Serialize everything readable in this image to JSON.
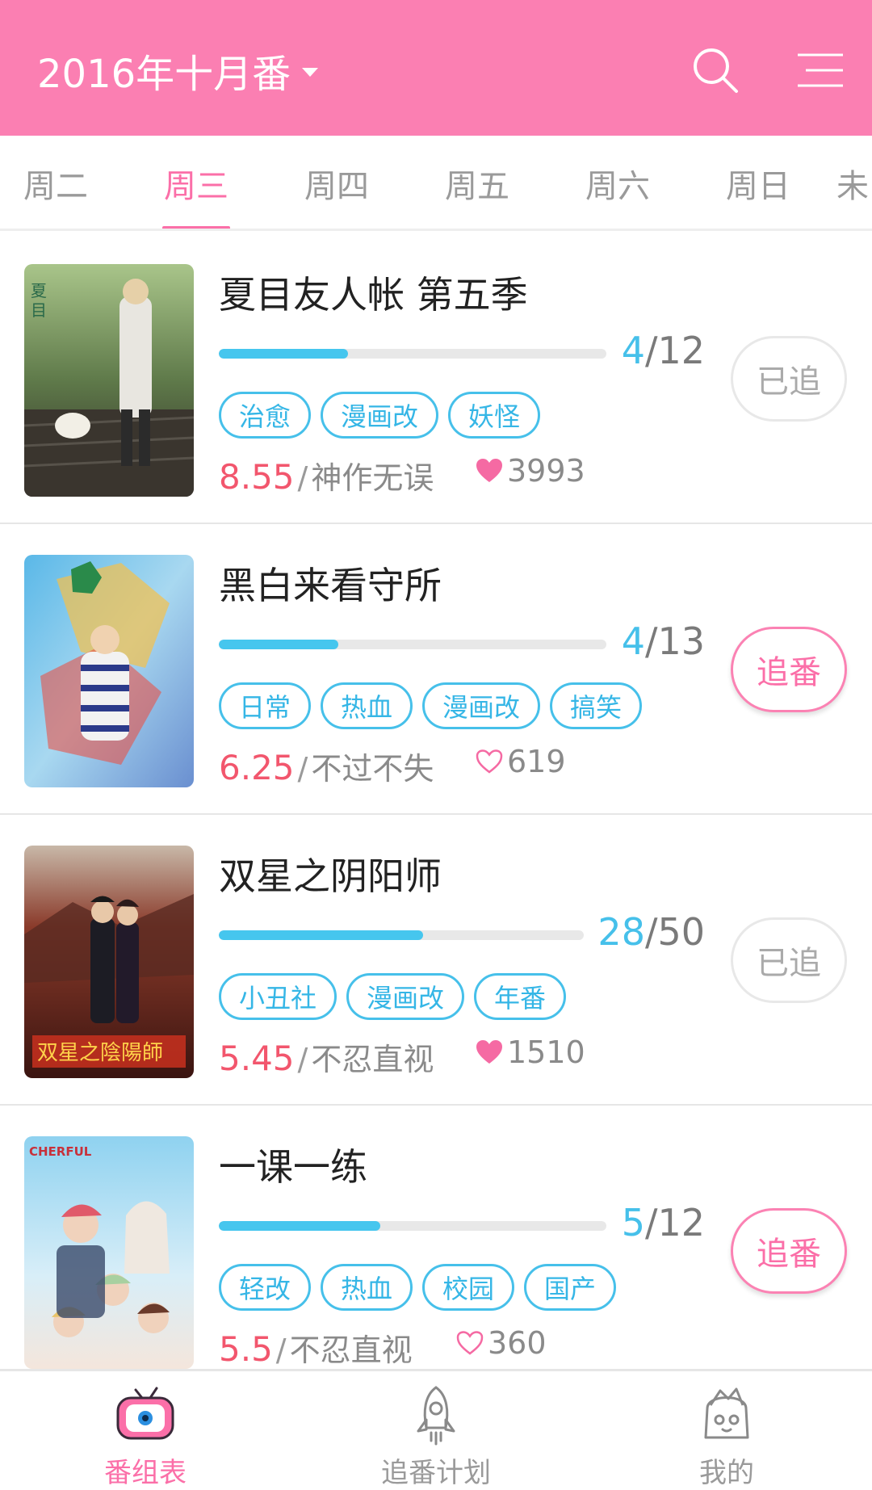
{
  "header": {
    "title": "2016年十月番",
    "search_icon": "search-icon",
    "menu_icon": "menu-icon",
    "background": "#fb7fb2"
  },
  "tabs": [
    {
      "label": "周二",
      "active": false
    },
    {
      "label": "周三",
      "active": true
    },
    {
      "label": "周四",
      "active": false
    },
    {
      "label": "周五",
      "active": false
    },
    {
      "label": "周六",
      "active": false
    },
    {
      "label": "周日",
      "active": false
    },
    {
      "label": "未",
      "active": false
    }
  ],
  "anime": [
    {
      "title": "夏目友人帐 第五季",
      "episode_current": "4",
      "episode_total": "/12",
      "progress": 0.333,
      "tags": [
        "治愈",
        "漫画改",
        "妖怪"
      ],
      "score": "8.55",
      "verdict": "神作无误",
      "likes": "3993",
      "liked": true,
      "button": "已追",
      "followed": true
    },
    {
      "title": "黑白来看守所",
      "episode_current": "4",
      "episode_total": "/13",
      "progress": 0.308,
      "tags": [
        "日常",
        "热血",
        "漫画改",
        "搞笑"
      ],
      "score": "6.25",
      "verdict": "不过不失",
      "likes": "619",
      "liked": false,
      "button": "追番",
      "followed": false
    },
    {
      "title": "双星之阴阳师",
      "episode_current": "28",
      "episode_total": "/50",
      "progress": 0.56,
      "tags": [
        "小丑社",
        "漫画改",
        "年番"
      ],
      "score": "5.45",
      "verdict": "不忍直视",
      "likes": "1510",
      "liked": true,
      "button": "已追",
      "followed": true
    },
    {
      "title": "一课一练",
      "episode_current": "5",
      "episode_total": "/12",
      "progress": 0.417,
      "tags": [
        "轻改",
        "热血",
        "校园",
        "国产"
      ],
      "score": "5.5",
      "verdict": "不忍直视",
      "likes": "360",
      "liked": false,
      "button": "追番",
      "followed": false
    }
  ],
  "bottom_nav": [
    {
      "label": "番组表",
      "icon": "tv-icon",
      "active": true
    },
    {
      "label": "追番计划",
      "icon": "rocket-icon",
      "active": false
    },
    {
      "label": "我的",
      "icon": "profile-character-icon",
      "active": false
    }
  ],
  "colors": {
    "accent_pink": "#fb6fa8",
    "progress_blue": "#46c6ee",
    "score_red": "#f2566d"
  }
}
